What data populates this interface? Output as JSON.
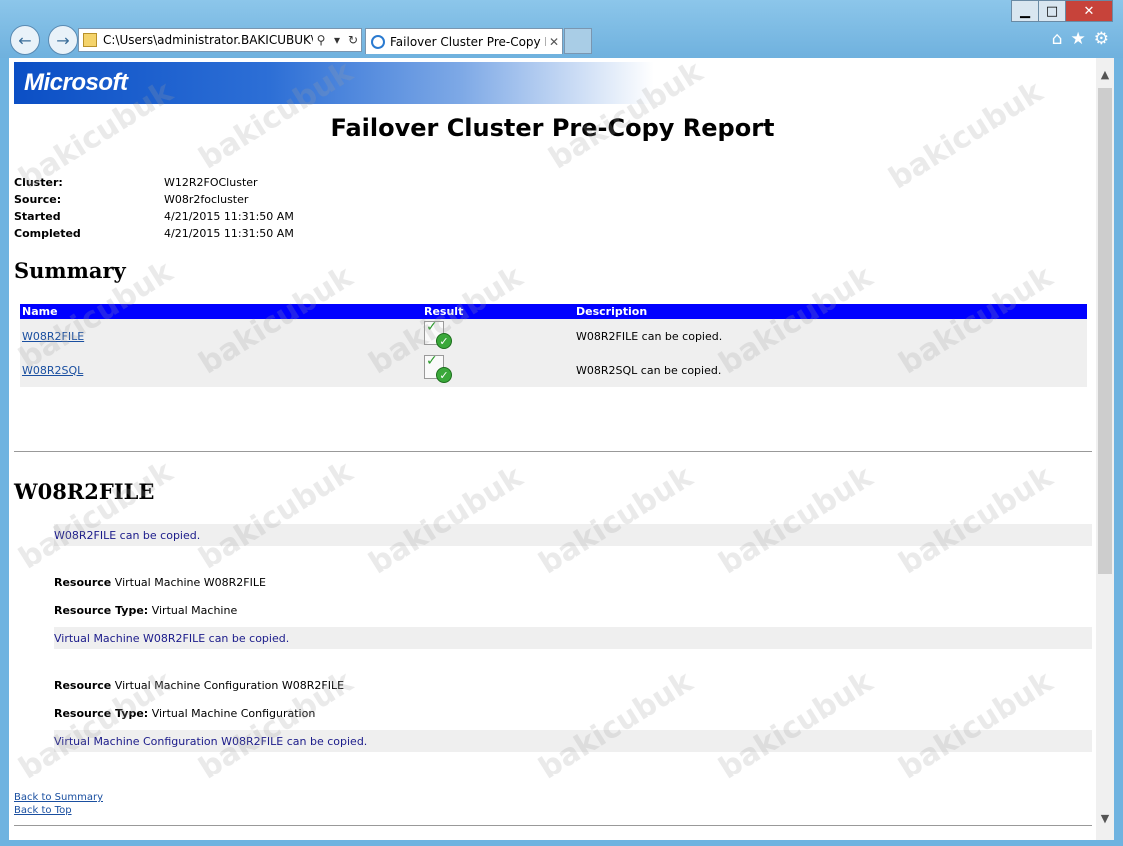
{
  "window_controls": {
    "minimize": "▁",
    "maximize": "□",
    "close": "✕"
  },
  "browser": {
    "back_icon": "back-arrow-icon",
    "forward_icon": "forward-arrow-icon",
    "address": "C:\\Users\\administrator.BAKICUBUK\\Ap",
    "tab_title": "Failover Cluster Pre-Copy R...",
    "tools": [
      "home-icon",
      "favorites-star-icon",
      "settings-gear-icon"
    ]
  },
  "report": {
    "logo": "Microsoft",
    "title": "Failover Cluster Pre-Copy Report",
    "meta": [
      {
        "key": "Cluster:",
        "value": "W12R2FOCluster"
      },
      {
        "key": "Source:",
        "value": "W08r2focluster"
      },
      {
        "key": "Started",
        "value": "4/21/2015 11:31:50 AM"
      },
      {
        "key": "Completed",
        "value": "4/21/2015 11:31:50 AM"
      }
    ],
    "summary_heading": "Summary",
    "summary_columns": [
      "Name",
      "Result",
      "Description"
    ],
    "summary_rows": [
      {
        "name": "W08R2FILE",
        "result_icon": "success-document-icon",
        "description": "W08R2FILE can be copied."
      },
      {
        "name": "W08R2SQL",
        "result_icon": "success-document-icon",
        "description": "W08R2SQL can be copied."
      }
    ],
    "section": {
      "heading": "W08R2FILE",
      "status": "W08R2FILE can be copied.",
      "resources": [
        {
          "resource_label": "Resource",
          "resource": "Virtual Machine W08R2FILE",
          "type_label": "Resource Type:",
          "type": "Virtual Machine",
          "status": "Virtual Machine W08R2FILE can be copied."
        },
        {
          "resource_label": "Resource",
          "resource": "Virtual Machine Configuration W08R2FILE",
          "type_label": "Resource Type:",
          "type": "Virtual Machine Configuration",
          "status": "Virtual Machine Configuration W08R2FILE can be copied."
        }
      ],
      "back_to_summary": "Back to Summary",
      "back_to_top": "Back to Top"
    }
  },
  "watermark": "bakicubuk"
}
